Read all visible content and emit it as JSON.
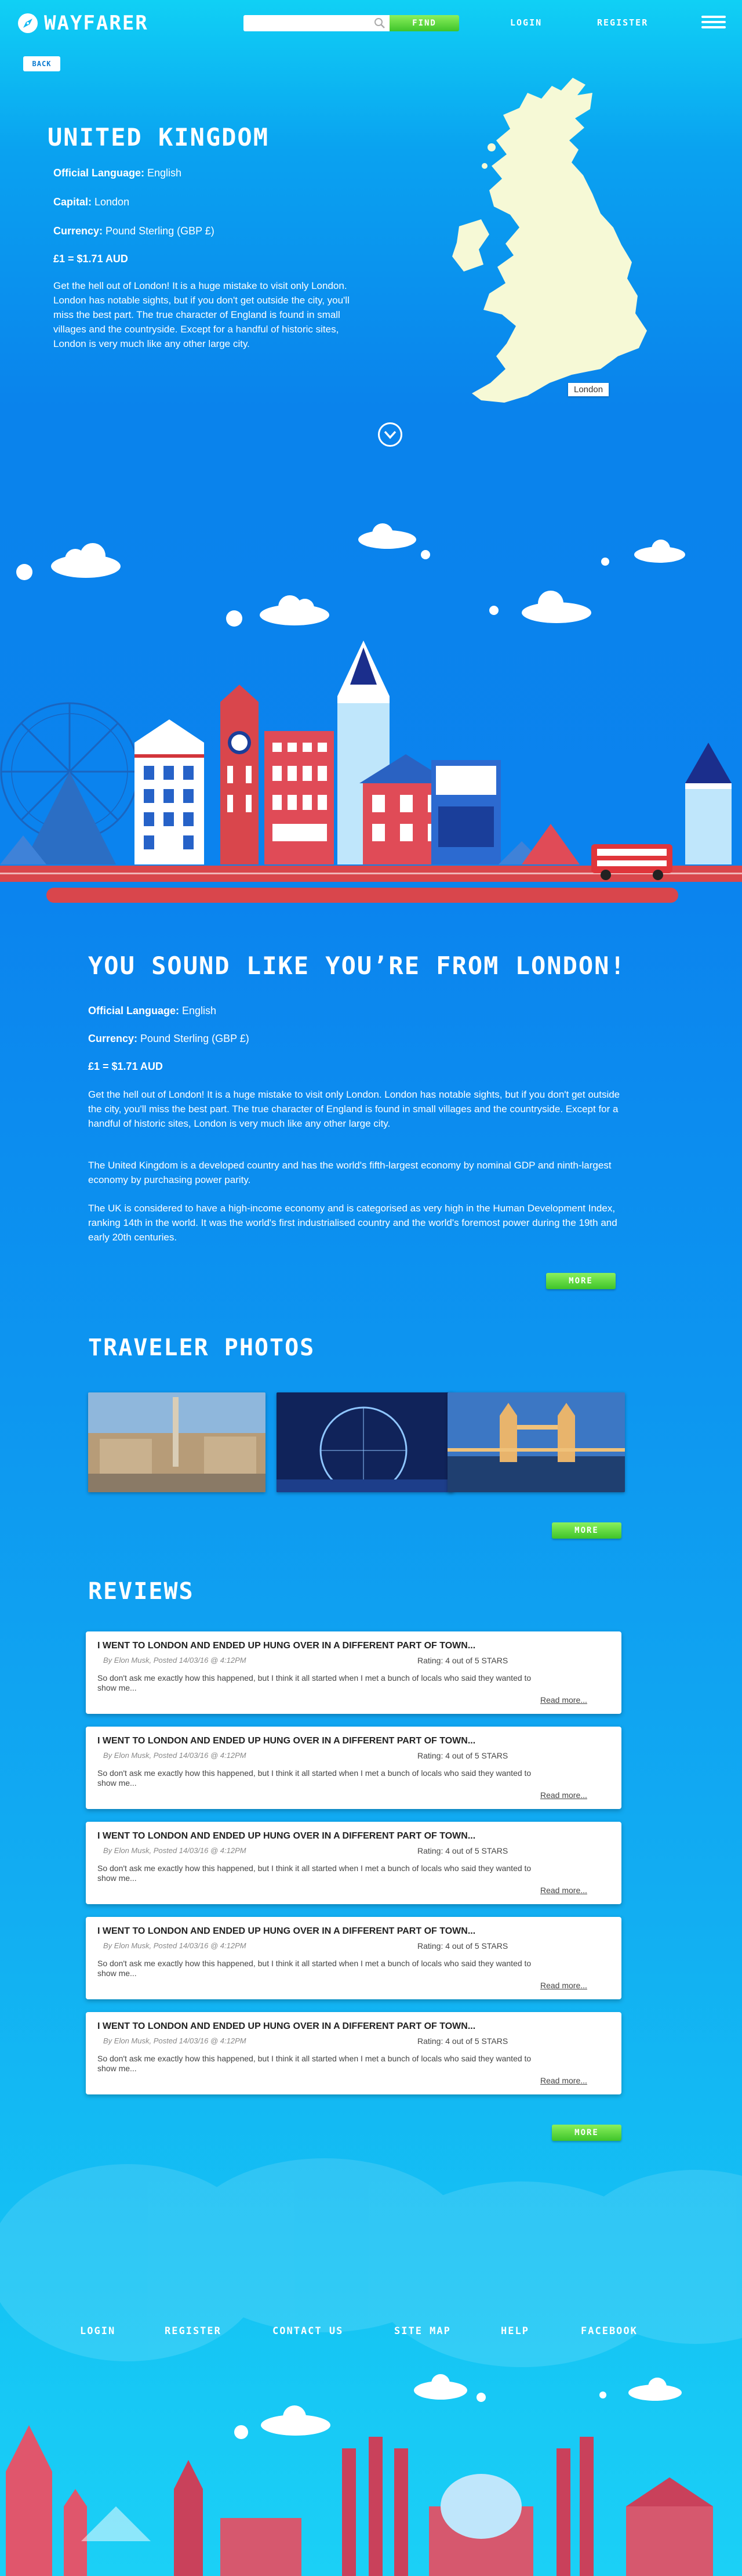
{
  "header": {
    "logo_text": "WAYFARER",
    "search": {
      "value": "",
      "placeholder": ""
    },
    "find_label": "FIND",
    "login_label": "LOGIN",
    "register_label": "REGISTER"
  },
  "back_label": "BACK",
  "hero": {
    "title": "UNITED KINGDOM",
    "language_label": "Official Language:",
    "language_value": " English",
    "capital_label": "Capital:",
    "capital_value": " London",
    "currency_label": "Currency:",
    "currency_value": " Pound Sterling (GBP £)",
    "rate": "£1 = $1.71 AUD",
    "description": "Get the hell out of London! It is a huge mistake to visit only London. London has notable sights, but if you don't get outside the city, you'll miss the best part. The true character of England is found in small villages and the countryside. Except for a handful of historic sites, London is very much like any other large city.",
    "map_label": "London"
  },
  "info": {
    "title": "YOU SOUND LIKE YOU’RE FROM LONDON!",
    "language_label": "Official Language:",
    "language_value": " English",
    "currency_label": "Currency:",
    "currency_value": " Pound Sterling (GBP £)",
    "rate": "£1 = $1.71 AUD",
    "paragraphs": [
      "Get the hell out of London! It is a huge mistake to visit only London. London has notable sights, but if you don't get outside the city, you'll miss the best part. The true character of England is found in small villages and the countryside. Except for a handful of historic sites, London is very much like any other large city.",
      "The United Kingdom is a developed country and has the world's fifth-largest economy by nominal GDP and ninth-largest economy by purchasing power parity.",
      "The UK is considered to have a high-income economy and is categorised as very high in the Human Development Index, ranking 14th in the world. It was the world's first industrialised country and the world's foremost power during the 19th and early 20th centuries."
    ],
    "more_label": "MORE"
  },
  "photos": {
    "title": "TRAVELER PHOTOS",
    "more_label": "MORE"
  },
  "reviews": {
    "title": "REVIEWS",
    "items": [
      {
        "title": "I WENT TO LONDON AND ENDED UP HUNG  OVER IN A DIFFERENT PART OF TOWN...",
        "byline": "By Elon Musk, Posted 14/03/16 @ 4:12PM",
        "rating": "Rating: 4 out of 5 STARS",
        "text": "So don't ask me exactly how this happened, but I think it all started when I met a bunch of locals who said they wanted to show me...",
        "more": "Read more..."
      },
      {
        "title": "I WENT TO LONDON AND ENDED UP HUNG  OVER IN A DIFFERENT PART OF TOWN...",
        "byline": "By Elon Musk, Posted 14/03/16 @ 4:12PM",
        "rating": "Rating: 4 out of 5 STARS",
        "text": "So don't ask me exactly how this happened, but I think it all started when I met a bunch of locals who said they wanted to show me...",
        "more": "Read more..."
      },
      {
        "title": "I WENT TO LONDON AND ENDED UP HUNG  OVER IN A DIFFERENT PART OF TOWN...",
        "byline": "By Elon Musk, Posted 14/03/16 @ 4:12PM",
        "rating": "Rating: 4 out of 5 STARS",
        "text": "So don't ask me exactly how this happened, but I think it all started when I met a bunch of locals who said they wanted to show me...",
        "more": "Read more..."
      },
      {
        "title": "I WENT TO LONDON AND ENDED UP HUNG  OVER IN A DIFFERENT PART OF TOWN...",
        "byline": "By Elon Musk, Posted 14/03/16 @ 4:12PM",
        "rating": "Rating: 4 out of 5 STARS",
        "text": "So don't ask me exactly how this happened, but I think it all started when I met a bunch of locals who said they wanted to show me...",
        "more": "Read more..."
      },
      {
        "title": "I WENT TO LONDON AND ENDED UP HUNG  OVER IN A DIFFERENT PART OF TOWN...",
        "byline": "By Elon Musk, Posted 14/03/16 @ 4:12PM",
        "rating": "Rating: 4 out of 5 STARS",
        "text": "So don't ask me exactly how this happened, but I think it all started when I met a bunch of locals who said they wanted to show me...",
        "more": "Read more..."
      }
    ],
    "more_label": "MORE"
  },
  "footer": {
    "links": [
      "LOGIN",
      "REGISTER",
      "CONTACT US",
      "SITE MAP",
      "HELP",
      "FACEBOOK"
    ]
  },
  "colors": {
    "accent_green": "#4fd235",
    "bus_red": "#e0353b",
    "road_red": "#d9464c",
    "map_cream": "#f6f9d6"
  }
}
